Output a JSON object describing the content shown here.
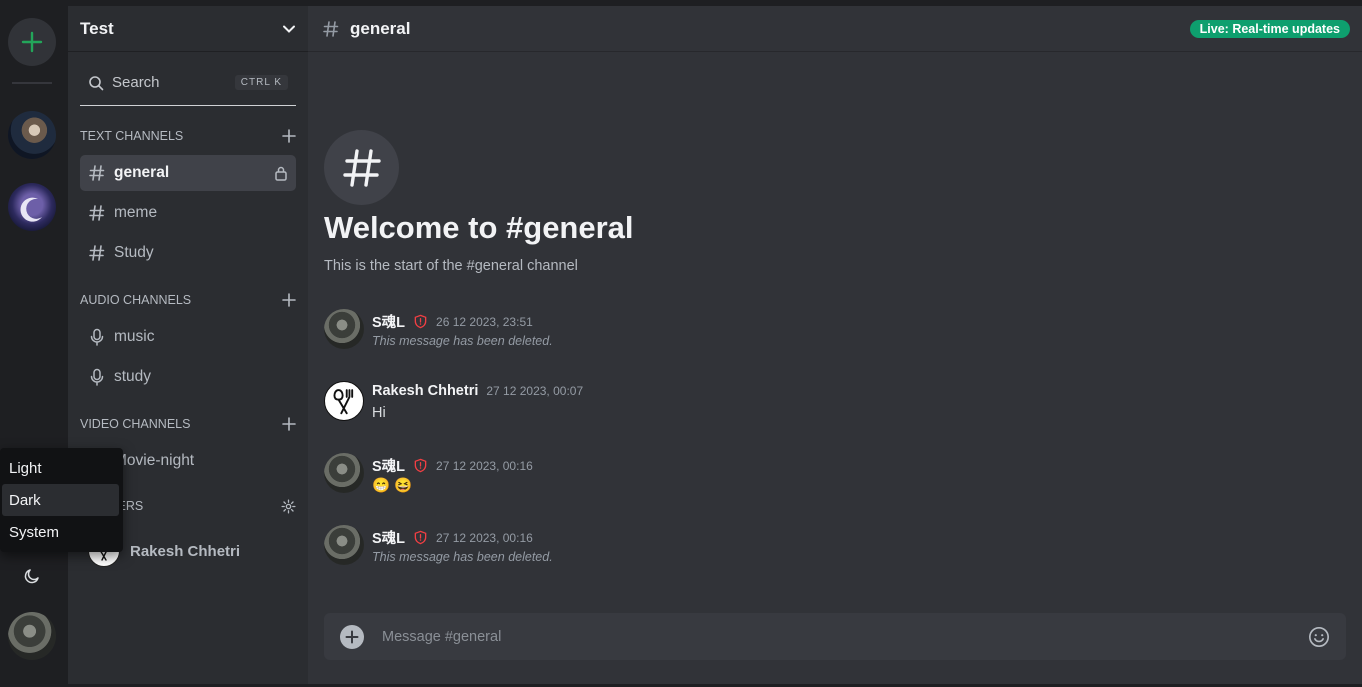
{
  "server": {
    "name": "Test"
  },
  "search": {
    "label": "Search",
    "shortcut": "CTRL K"
  },
  "sections": {
    "text": {
      "title": "TEXT CHANNELS",
      "channels": [
        "general",
        "meme",
        "Study"
      ]
    },
    "audio": {
      "title": "AUDIO CHANNELS",
      "channels": [
        "music",
        "study"
      ]
    },
    "video": {
      "title": "VIDEO CHANNELS",
      "channels": [
        "Movie-night"
      ]
    },
    "members": {
      "title": "MEMBERS",
      "visible_fragment": "RS",
      "items": [
        "Rakesh Chhetri"
      ]
    }
  },
  "theme_menu": {
    "options": [
      "Light",
      "Dark",
      "System"
    ],
    "highlighted": "Dark"
  },
  "chat": {
    "channel": "general",
    "live_badge": "Live: Real-time updates",
    "welcome_title": "Welcome to #general",
    "welcome_sub": "This is the start of the #general channel",
    "messages": [
      {
        "author": "S魂L",
        "admin": true,
        "time": "26 12 2023, 23:51",
        "body": "This message has been deleted.",
        "deleted": true
      },
      {
        "author": "Rakesh Chhetri",
        "admin": false,
        "time": "27 12 2023, 00:07",
        "body": "Hi",
        "deleted": false
      },
      {
        "author": "S魂L",
        "admin": true,
        "time": "27 12 2023, 00:16",
        "body": "😁 😆",
        "deleted": false
      },
      {
        "author": "S魂L",
        "admin": true,
        "time": "27 12 2023, 00:16",
        "body": "This message has been deleted.",
        "deleted": true
      }
    ],
    "composer_placeholder": "Message #general"
  },
  "colors": {
    "accent_green": "#23a55a",
    "live_badge": "#0e9f6e",
    "admin_shield": "#f23f43",
    "background": "#313338",
    "sidebar": "#2b2d31",
    "rail": "#1e1f22"
  }
}
